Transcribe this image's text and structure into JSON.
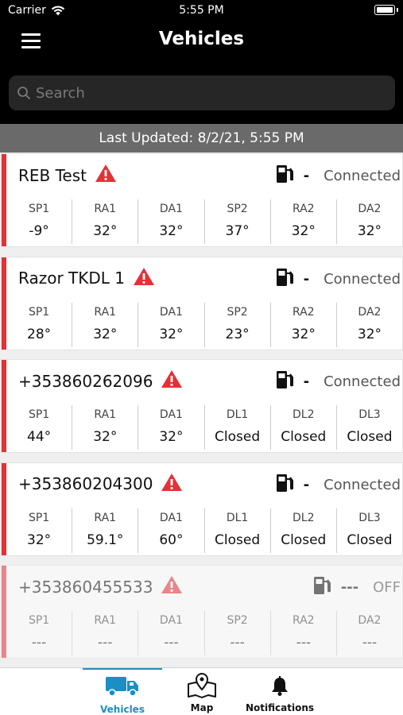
{
  "status_bar": {
    "carrier": "Carrier",
    "time": "5:55 PM"
  },
  "header": {
    "title": "Vehicles"
  },
  "search": {
    "placeholder": "Search"
  },
  "last_updated": "Last Updated: 8/2/21, 5:55 PM",
  "colors": {
    "alert_red": "#e43136",
    "accent_blue": "#1a8fc4",
    "header_bg": "#000000"
  },
  "vehicles": [
    {
      "name": "REB Test",
      "alert": "warning-icon",
      "fuel_value": "-",
      "connection": "Connected",
      "readings": [
        {
          "label": "SP1",
          "value": "-9°"
        },
        {
          "label": "RA1",
          "value": "32°"
        },
        {
          "label": "DA1",
          "value": "32°"
        },
        {
          "label": "SP2",
          "value": "37°"
        },
        {
          "label": "RA2",
          "value": "32°"
        },
        {
          "label": "DA2",
          "value": "32°"
        }
      ]
    },
    {
      "name": "Razor TKDL 1",
      "alert": "warning-icon",
      "fuel_value": "-",
      "connection": "Connected",
      "readings": [
        {
          "label": "SP1",
          "value": "28°"
        },
        {
          "label": "RA1",
          "value": "32°"
        },
        {
          "label": "DA1",
          "value": "32°"
        },
        {
          "label": "SP2",
          "value": "23°"
        },
        {
          "label": "RA2",
          "value": "32°"
        },
        {
          "label": "DA2",
          "value": "32°"
        }
      ]
    },
    {
      "name": "+353860262096",
      "alert": "warning-icon",
      "fuel_value": "-",
      "connection": "Connected",
      "readings": [
        {
          "label": "SP1",
          "value": "44°"
        },
        {
          "label": "RA1",
          "value": "32°"
        },
        {
          "label": "DA1",
          "value": "32°"
        },
        {
          "label": "DL1",
          "value": "Closed"
        },
        {
          "label": "DL2",
          "value": "Closed"
        },
        {
          "label": "DL3",
          "value": "Closed"
        }
      ]
    },
    {
      "name": "+353860204300",
      "alert": "warning-icon",
      "fuel_value": "-",
      "connection": "Connected",
      "readings": [
        {
          "label": "SP1",
          "value": "32°"
        },
        {
          "label": "RA1",
          "value": "59.1°"
        },
        {
          "label": "DA1",
          "value": "60°"
        },
        {
          "label": "DL1",
          "value": "Closed"
        },
        {
          "label": "DL2",
          "value": "Closed"
        },
        {
          "label": "DL3",
          "value": "Closed"
        }
      ]
    },
    {
      "name": "+353860455533",
      "alert": "warning-icon",
      "fuel_value": "---",
      "connection": "OFF",
      "readings": [
        {
          "label": "SP1",
          "value": "---"
        },
        {
          "label": "RA1",
          "value": "---"
        },
        {
          "label": "DA1",
          "value": "---"
        },
        {
          "label": "SP2",
          "value": "---"
        },
        {
          "label": "RA2",
          "value": "---"
        },
        {
          "label": "DA2",
          "value": "---"
        }
      ]
    }
  ],
  "tabs": [
    {
      "label": "Vehicles",
      "icon": "truck-icon",
      "active": true
    },
    {
      "label": "Map",
      "icon": "map-icon",
      "active": false
    },
    {
      "label": "Notifications",
      "icon": "bell-icon",
      "active": false
    }
  ]
}
